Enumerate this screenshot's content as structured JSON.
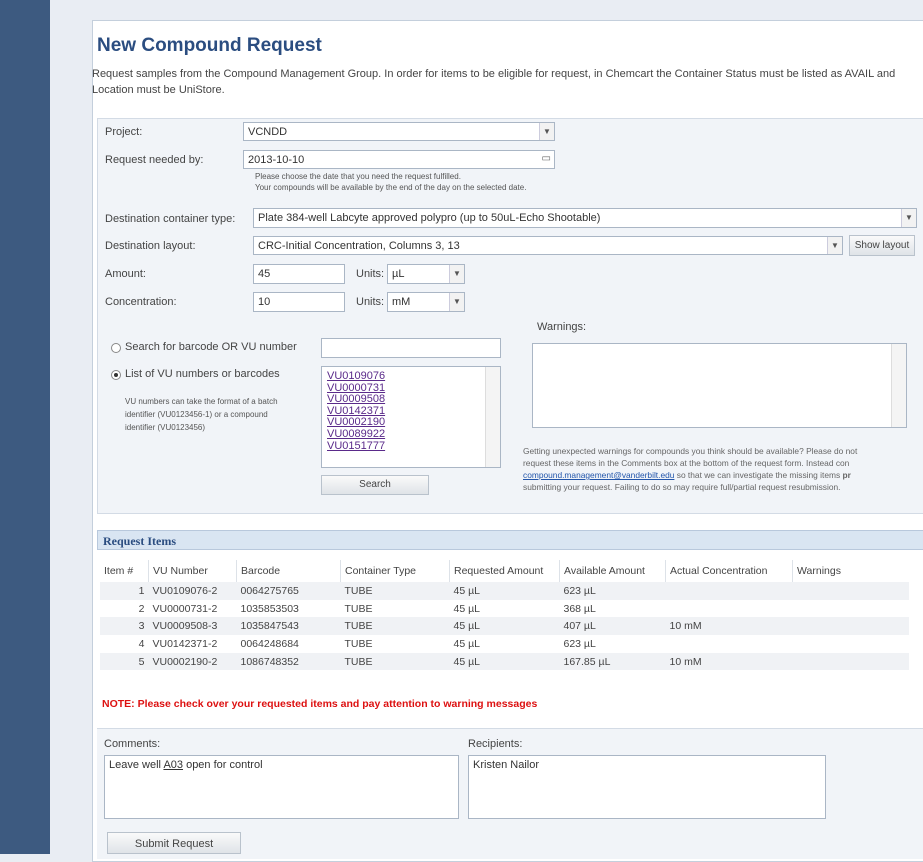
{
  "page": {
    "title": "New Compound Request",
    "intro_line1": "Request samples from the Compound Management Group. In order for items to be eligible for request, in Chemcart the Container Status must be listed as AVAIL and",
    "intro_line2": "Location must be UniStore."
  },
  "form": {
    "project_label": "Project:",
    "project_value": "VCNDD",
    "needed_label": "Request needed by:",
    "needed_value": "2013-10-10",
    "needed_help1": "Please choose the date that you need the request fulfilled.",
    "needed_help2": "Your compounds will be available by the end of the day on the selected date.",
    "dest_type_label": "Destination container type:",
    "dest_type_value": "Plate 384-well Labcyte approved polypro (up to 50uL-Echo Shootable)",
    "dest_layout_label": "Destination layout:",
    "dest_layout_value": "CRC-Initial Concentration, Columns 3, 13",
    "show_layout_button": "Show layout",
    "amount_label": "Amount:",
    "amount_value": "45",
    "amount_units_label": "Units:",
    "amount_units_value": "µL",
    "conc_label": "Concentration:",
    "conc_value": "10",
    "conc_units_label": "Units:",
    "conc_units_value": "mM"
  },
  "search": {
    "option1_label": "Search for barcode OR VU number",
    "option2_label": "List of VU numbers or barcodes",
    "help1": "VU numbers can take the format of a batch",
    "help2": "identifier (VU0123456-1) or a compound",
    "help3": "identifier (VU0123456)",
    "vu_list": [
      "VU0109076",
      "VU0000731",
      "VU0009508",
      "VU0142371",
      "VU0002190",
      "VU0089922",
      "VU0151777"
    ],
    "search_button": "Search"
  },
  "warnings": {
    "label": "Warnings:",
    "note_line1": "Getting unexpected warnings for compounds you think should be available? Please do not",
    "note_line2": "request these items in the Comments box at the bottom of the request form. Instead con",
    "note_link": "compound.management@vanderbilt.edu",
    "note_line3_rest": " so that we can investigate the missing items ",
    "note_line3_bold": "pr",
    "note_line4": "submitting your request. Failing to do so may require full/partial request resubmission."
  },
  "request_items": {
    "header": "Request Items",
    "columns": [
      "Item #",
      "VU Number",
      "Barcode",
      "Container Type",
      "Requested Amount",
      "Available Amount",
      "Actual Concentration",
      "Warnings"
    ],
    "rows": [
      [
        "1",
        "VU0109076-2",
        "0064275765",
        "TUBE",
        "45 µL",
        "623 µL",
        "",
        ""
      ],
      [
        "2",
        "VU0000731-2",
        "1035853503",
        "TUBE",
        "45 µL",
        "368 µL",
        "",
        ""
      ],
      [
        "3",
        "VU0009508-3",
        "1035847543",
        "TUBE",
        "45 µL",
        "407 µL",
        "10 mM",
        ""
      ],
      [
        "4",
        "VU0142371-2",
        "0064248684",
        "TUBE",
        "45 µL",
        "623 µL",
        "",
        ""
      ],
      [
        "5",
        "VU0002190-2",
        "1086748352",
        "TUBE",
        "45 µL",
        "167.85 µL",
        "10 mM",
        ""
      ]
    ],
    "note": "NOTE: Please check over your requested items and pay attention to warning messages"
  },
  "comments": {
    "label": "Comments:",
    "value_pre": "Leave well ",
    "value_u": "A03",
    "value_post": " open for control",
    "recipients_label": "Recipients:",
    "recipients_value": "Kristen Nailor",
    "submit_button": "Submit Request"
  }
}
